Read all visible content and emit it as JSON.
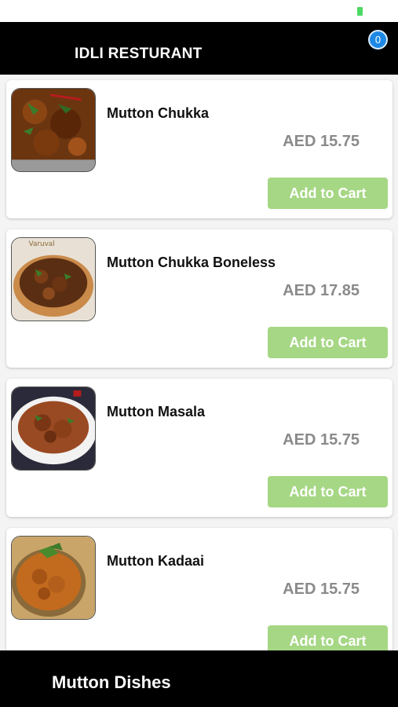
{
  "header": {
    "title": "IDLI RESTURANT",
    "cart_count": "0"
  },
  "items": [
    {
      "name": "Mutton Chukka",
      "price": "AED 15.75",
      "button": "Add to Cart",
      "image": "mutton-chukka-photo"
    },
    {
      "name": "Mutton Chukka Boneless",
      "price": "AED 17.85",
      "button": "Add to Cart",
      "image": "mutton-chukka-boneless-photo",
      "image_caption": "Varuval"
    },
    {
      "name": "Mutton Masala",
      "price": "AED 15.75",
      "button": "Add to Cart",
      "image": "mutton-masala-photo"
    },
    {
      "name": "Mutton Kadaai",
      "price": "AED 15.75",
      "button": "Add to Cart",
      "image": "mutton-kadaai-photo"
    }
  ],
  "footer": {
    "title": "Mutton Dishes"
  },
  "colors": {
    "header_bg": "#000000",
    "button_bg": "#a6d785",
    "price": "#8a8a8a",
    "badge": "#1e88e5"
  }
}
